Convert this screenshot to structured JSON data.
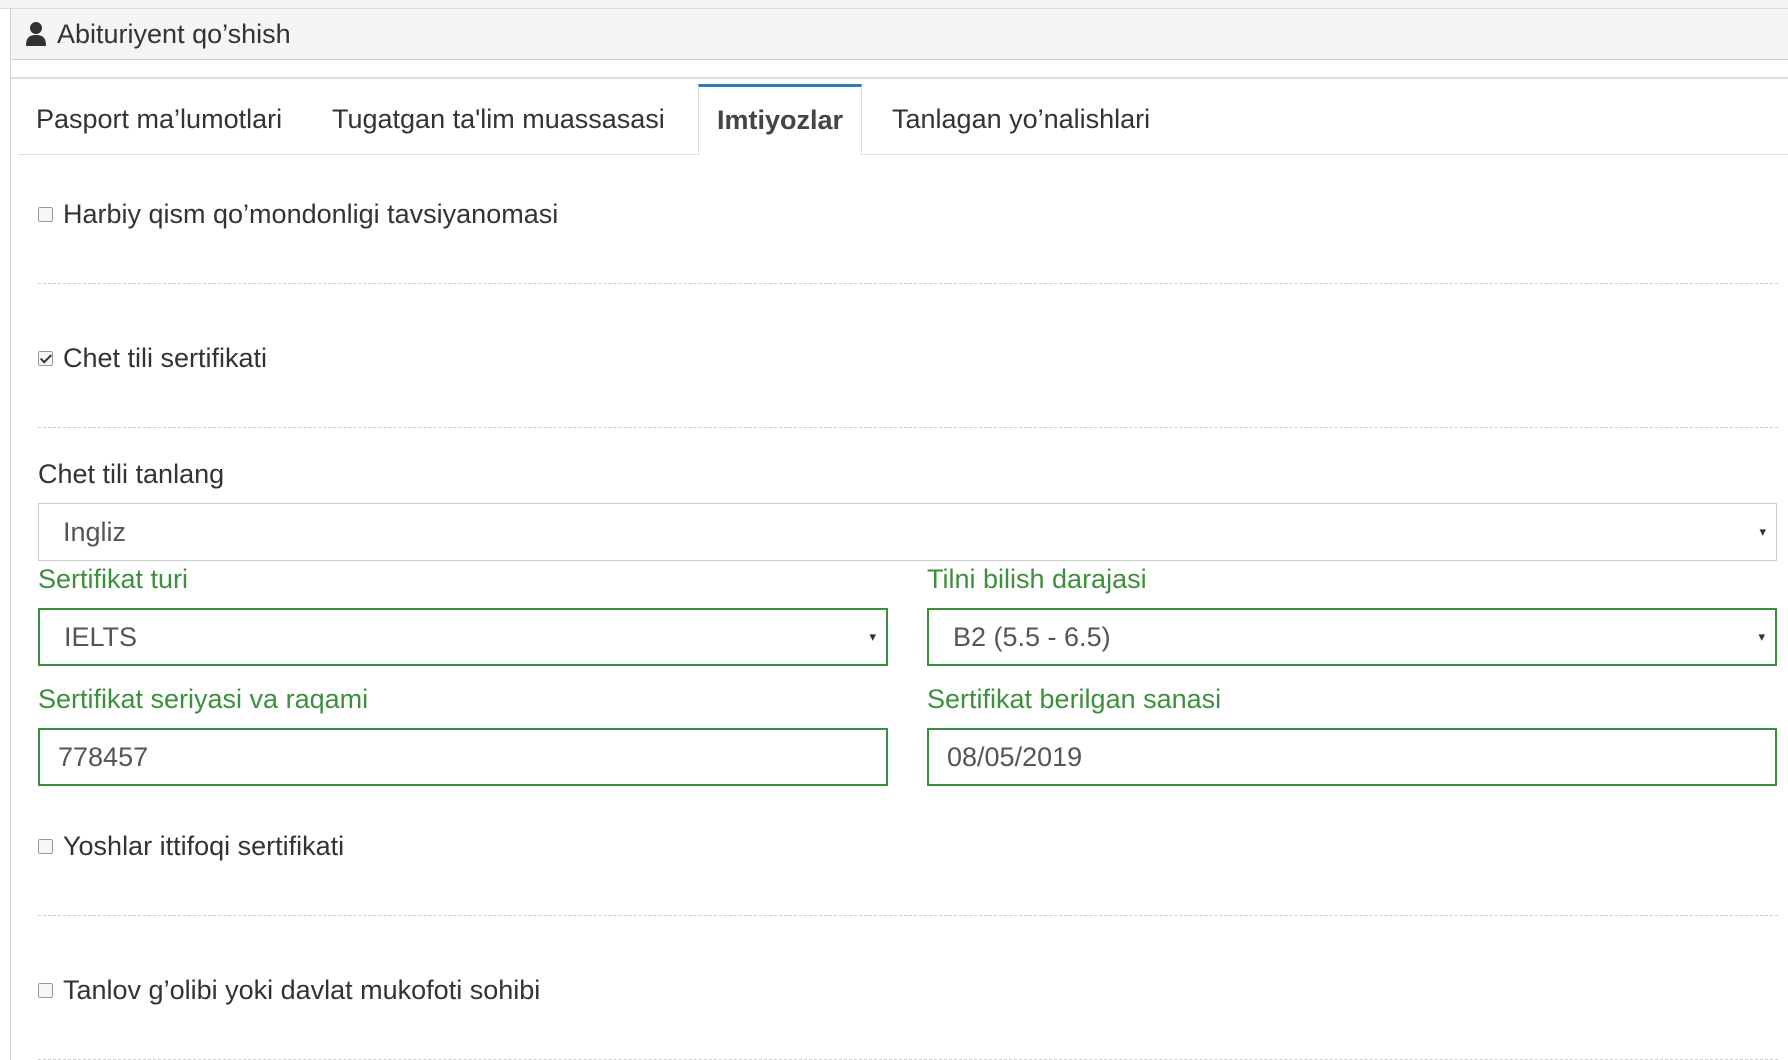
{
  "window": {
    "title": "Abituriyent qo’shish",
    "icon": "user-icon"
  },
  "tabs": [
    {
      "label": "Pasport ma’lumotlari",
      "active": false
    },
    {
      "label": "Tugatgan ta'lim muassasasi",
      "active": false
    },
    {
      "label": "Imtiyozlar",
      "active": true
    },
    {
      "label": "Tanlagan yo’nalishlari",
      "active": false
    }
  ],
  "privileges": {
    "military": {
      "label": "Harbiy qism qo’mondonligi tavsiyanomasi",
      "checked": false
    },
    "foreign_lang": {
      "label": "Chet tili sertifikati",
      "checked": true
    },
    "youth": {
      "label": "Yoshlar ittifoqi sertifikati",
      "checked": false
    },
    "winner": {
      "label": "Tanlov g’olibi yoki davlat mukofoti sohibi",
      "checked": false
    }
  },
  "language_form": {
    "language": {
      "label": "Chet tili tanlang",
      "value": "Ingliz"
    },
    "cert_type": {
      "label": "Sertifikat turi",
      "value": "IELTS"
    },
    "level": {
      "label": "Tilni bilish darajasi",
      "value": "B2 (5.5 - 6.5)"
    },
    "serial": {
      "label": "Sertifikat seriyasi va raqami",
      "value": "778457"
    },
    "date": {
      "label": "Sertifikat berilgan sanasi",
      "value": "08/05/2019"
    }
  },
  "colors": {
    "accent_green": "#3d8f3d",
    "tab_active_border": "#3a78a6",
    "border": "#cccccc"
  },
  "icons": {
    "dropdown": "▾"
  }
}
